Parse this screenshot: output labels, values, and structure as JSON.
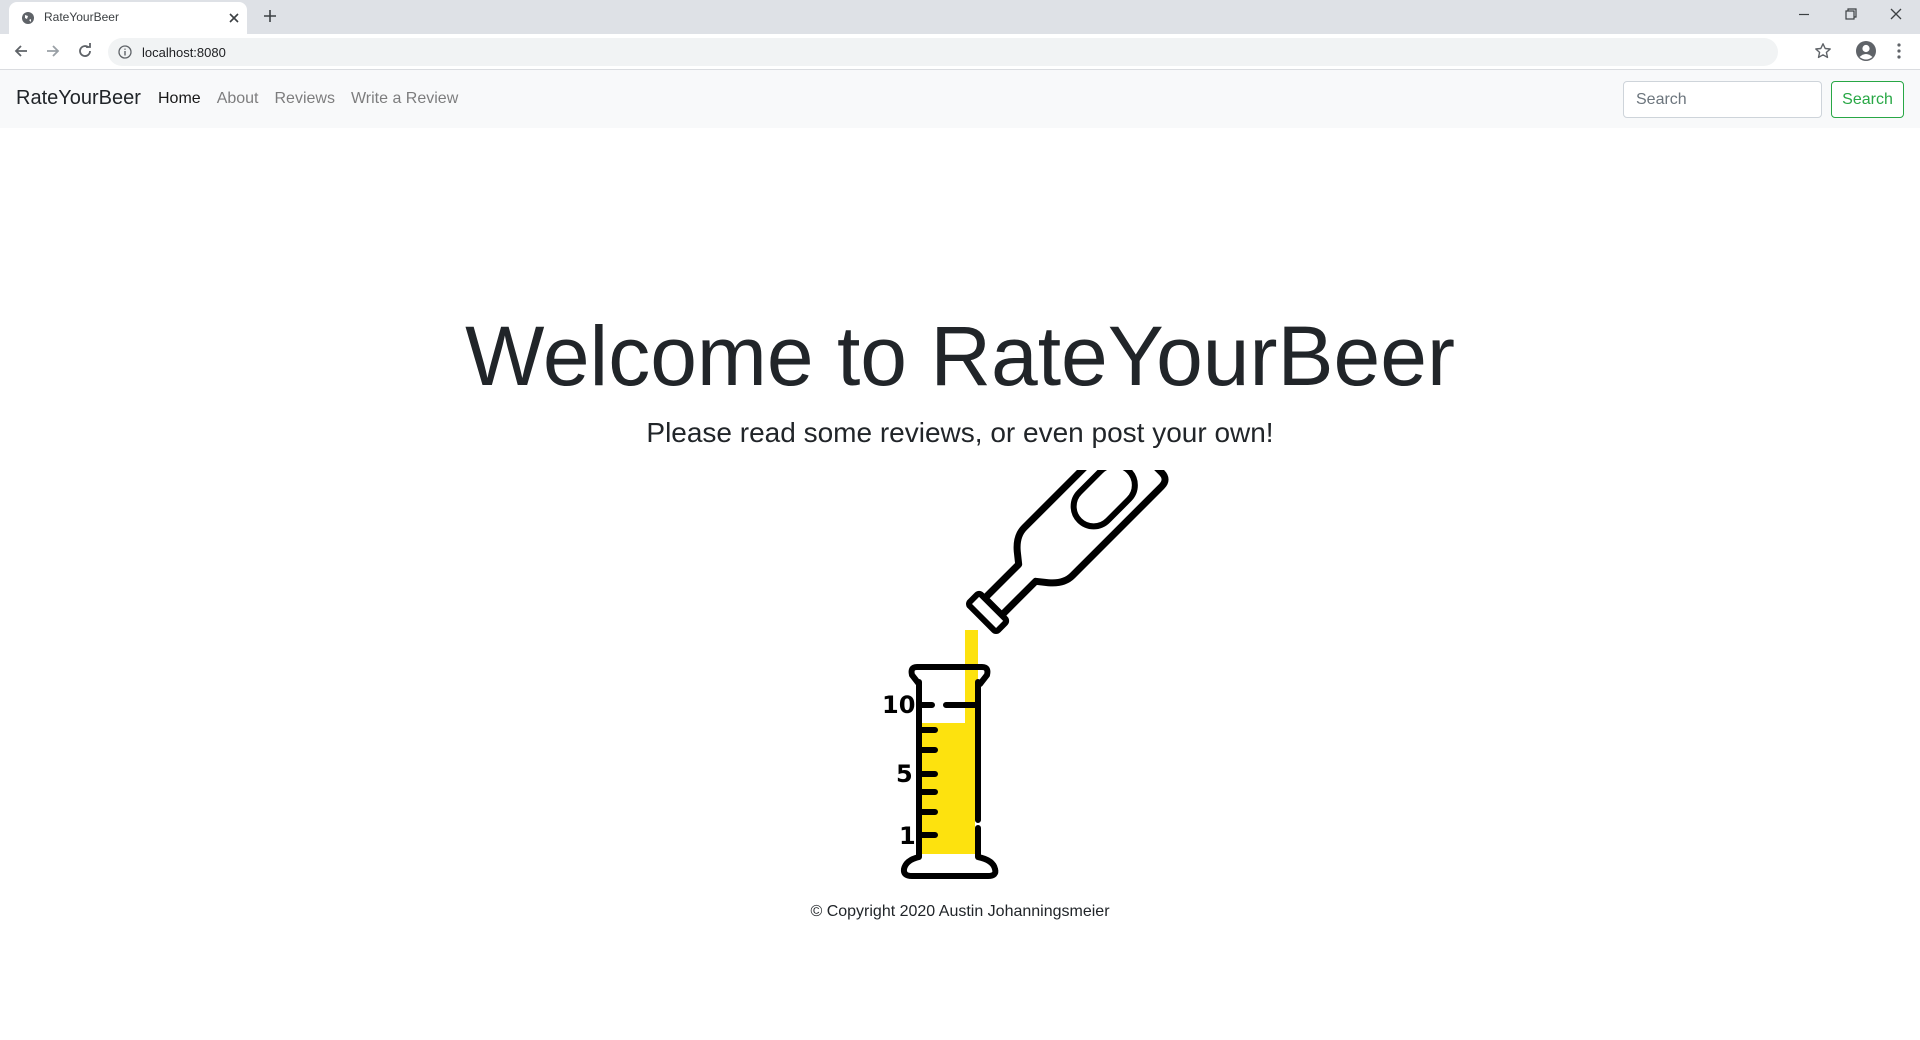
{
  "browser": {
    "tab_title": "RateYourBeer",
    "url": "localhost:8080"
  },
  "navbar": {
    "brand": "RateYourBeer",
    "links": [
      {
        "label": "Home",
        "active": true
      },
      {
        "label": "About",
        "active": false
      },
      {
        "label": "Reviews",
        "active": false
      },
      {
        "label": "Write a Review",
        "active": false
      }
    ],
    "search_placeholder": "Search",
    "search_button": "Search"
  },
  "hero": {
    "title": "Welcome to RateYourBeer",
    "subtitle": "Please read some reviews, or even post your own!",
    "illustration": {
      "icon": "beer-pouring-into-measuring-cylinder",
      "scale_labels": [
        "10",
        "5",
        "1"
      ],
      "beer_color": "#fde20e"
    }
  },
  "footer": {
    "copyright": "© Copyright 2020 Austin Johanningsmeier"
  },
  "colors": {
    "navbar_bg": "#f8f9fa",
    "success": "#28a745",
    "tabbar_bg": "#dee1e6"
  }
}
